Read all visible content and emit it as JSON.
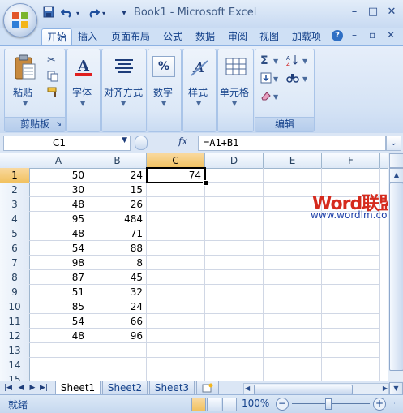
{
  "window": {
    "title": "Book1 - Microsoft Excel",
    "qat": {
      "save_icon": "save-icon",
      "undo_icon": "undo-icon",
      "redo_icon": "redo-icon",
      "customize_icon": "customize-qat-icon"
    },
    "controls": {
      "minimize": "–",
      "restore": "□",
      "close": "✕"
    }
  },
  "tabs": [
    {
      "label": "开始",
      "active": true
    },
    {
      "label": "插入"
    },
    {
      "label": "页面布局"
    },
    {
      "label": "公式"
    },
    {
      "label": "数据"
    },
    {
      "label": "审阅"
    },
    {
      "label": "视图"
    },
    {
      "label": "加载项"
    }
  ],
  "ribbon_right": {
    "help": "?",
    "minimize": "–",
    "restore": "▫",
    "close": "✕"
  },
  "ribbon": {
    "clipboard": {
      "paste_label": "粘贴",
      "group_label": "剪贴板"
    },
    "font": {
      "label": "字体"
    },
    "alignment": {
      "label": "对齐方式"
    },
    "number": {
      "label": "数字",
      "icon_text": "%"
    },
    "styles": {
      "label": "样式"
    },
    "cells": {
      "label": "单元格"
    },
    "editing": {
      "label": "编辑",
      "sigma": "Σ"
    }
  },
  "formula_bar": {
    "name_box": "C1",
    "fx": "fx",
    "formula": "=A1+B1"
  },
  "grid": {
    "columns": [
      "A",
      "B",
      "C",
      "D",
      "E",
      "F"
    ],
    "selected_column": "C",
    "selected_row": 1,
    "rows": [
      {
        "n": "1",
        "a": "50",
        "b": "24",
        "c": "74"
      },
      {
        "n": "2",
        "a": "30",
        "b": "15",
        "c": ""
      },
      {
        "n": "3",
        "a": "48",
        "b": "26",
        "c": ""
      },
      {
        "n": "4",
        "a": "95",
        "b": "484",
        "c": ""
      },
      {
        "n": "5",
        "a": "48",
        "b": "71",
        "c": ""
      },
      {
        "n": "6",
        "a": "54",
        "b": "88",
        "c": ""
      },
      {
        "n": "7",
        "a": "98",
        "b": "8",
        "c": ""
      },
      {
        "n": "8",
        "a": "87",
        "b": "45",
        "c": ""
      },
      {
        "n": "9",
        "a": "51",
        "b": "32",
        "c": ""
      },
      {
        "n": "10",
        "a": "85",
        "b": "24",
        "c": ""
      },
      {
        "n": "11",
        "a": "54",
        "b": "66",
        "c": ""
      },
      {
        "n": "12",
        "a": "48",
        "b": "96",
        "c": ""
      },
      {
        "n": "13",
        "a": "",
        "b": "",
        "c": ""
      },
      {
        "n": "14",
        "a": "",
        "b": "",
        "c": ""
      },
      {
        "n": "15",
        "a": "",
        "b": "",
        "c": ""
      }
    ]
  },
  "watermark": {
    "word": "Word",
    "cn": "联盟",
    "url": "www.wordlm.com"
  },
  "sheets": [
    {
      "label": "Sheet1",
      "active": true
    },
    {
      "label": "Sheet2"
    },
    {
      "label": "Sheet3"
    }
  ],
  "status": {
    "text": "就绪",
    "zoom": "100%",
    "zoom_minus": "−",
    "zoom_plus": "+"
  },
  "colors": {
    "accent": "#15428b",
    "ribbon_bg": "#dce8f7",
    "selection_header": "#f1c15f",
    "watermark_red": "#d52b1e",
    "watermark_blue": "#1b3ea8"
  }
}
